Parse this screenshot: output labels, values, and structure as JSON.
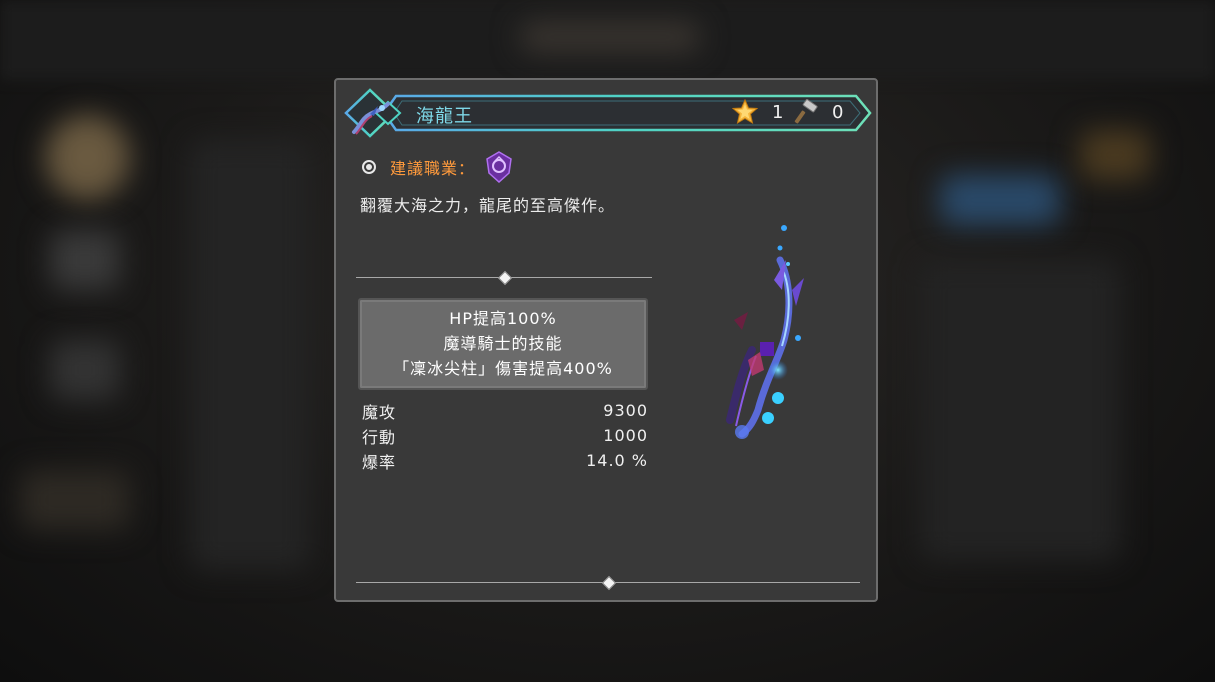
{
  "item": {
    "name": "海龍王",
    "stars": "1",
    "hammers": "0",
    "job_label": "建議職業：",
    "description": "翻覆大海之力，龍尾的至高傑作。",
    "effects": [
      "HP提高100%",
      "魔導騎士的技能",
      "「凜冰尖柱」傷害提高400%"
    ],
    "stats": [
      {
        "name": "魔攻",
        "value": "9300"
      },
      {
        "name": "行動",
        "value": "1000"
      },
      {
        "name": "爆率",
        "value": "14.0 %"
      }
    ]
  },
  "icons": {
    "weapon": "whip-weapon-icon",
    "star": "star-icon",
    "hammer": "hammer-icon",
    "job": "magic-knight-class-icon",
    "radio": "radio-icon"
  },
  "colors": {
    "name": "#7ed8e8",
    "job_label": "#ff9a3c",
    "frame_teal": "#4fd3c4",
    "frame_blue": "#5aa8e8",
    "panel_bg": "#393939"
  }
}
